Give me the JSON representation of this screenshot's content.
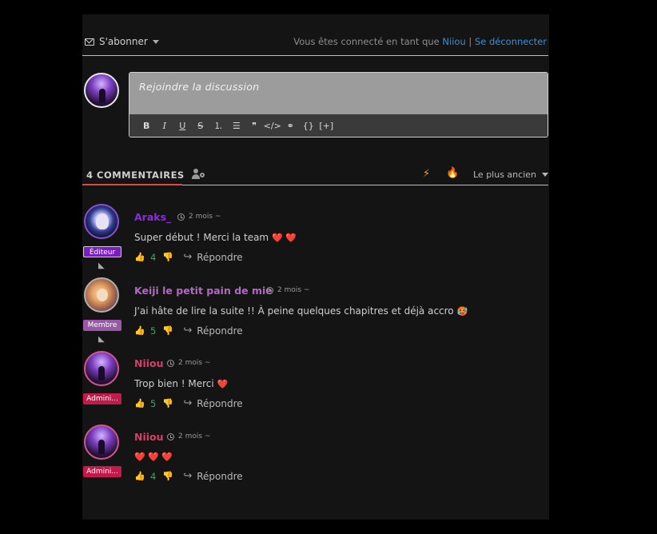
{
  "topbar": {
    "subscribe_label": "S'abonner",
    "logged_prefix": "Vous êtes connecté en tant que",
    "username": "Niiou",
    "separator": "|",
    "logout_label": "Se déconnecter"
  },
  "composer": {
    "placeholder": "Rejoindre la discussion",
    "toolbar": [
      "B",
      "I",
      "U",
      "S",
      "ordered-list",
      "bulleted-list",
      "quote",
      "</>",
      "link",
      "{}",
      "[+]"
    ]
  },
  "comments_header": {
    "count_label": "4 COMMENTAIRES",
    "sort_label": "Le plus ancien"
  },
  "comments": [
    {
      "author": "Araks_",
      "author_color": "#8a2be2",
      "role": "Éditeur",
      "time": "2 mois ~",
      "text": "Super début ! Merci la team",
      "hearts": "❤️ ❤️",
      "votes": "4",
      "reply_label": "Répondre"
    },
    {
      "author": "Keiji le petit pain de mie",
      "author_color": "#b06ac0",
      "role": "Membre",
      "time": "2 mois ~",
      "text": "J'ai hâte de lire la suite !! À peine quelques chapitres et déjà accro",
      "emoji": "🥵",
      "votes": "5",
      "reply_label": "Répondre"
    },
    {
      "author": "Niiou",
      "author_color": "#d4406a",
      "role": "Admini...",
      "time": "2 mois ~",
      "text": "Trop bien ! Merci",
      "hearts": "❤️",
      "votes": "5",
      "reply_label": "Répondre"
    },
    {
      "author": "Niiou",
      "author_color": "#d4406a",
      "role": "Admini...",
      "time": "2 mois ~",
      "text": "",
      "hearts": "❤️ ❤️ ❤️",
      "votes": "4",
      "reply_label": "Répondre"
    }
  ]
}
